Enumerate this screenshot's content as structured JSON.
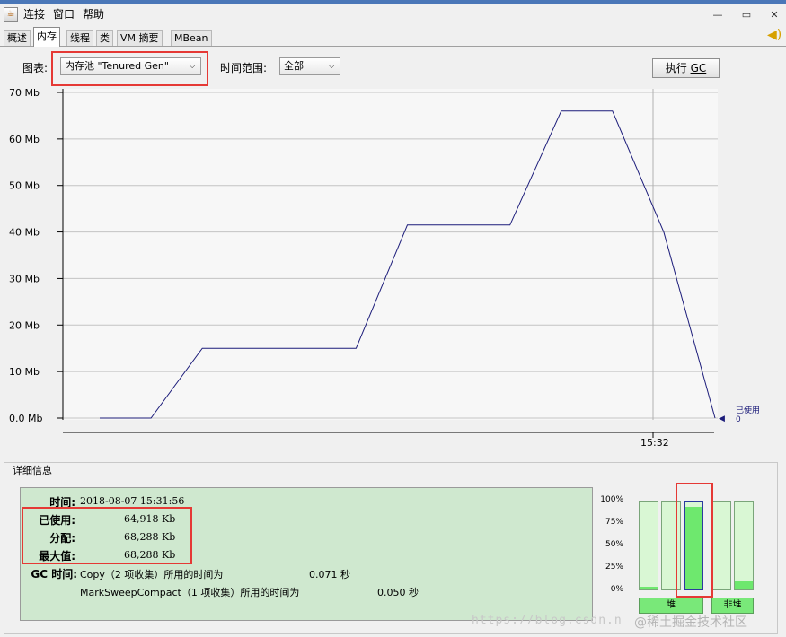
{
  "app": {
    "menu": [
      "连接",
      "窗口",
      "帮助"
    ]
  },
  "window_buttons": {
    "minimize": "—",
    "restore": "▭",
    "close": "✕"
  },
  "tabs": [
    "概述",
    "内存",
    "线程",
    "类",
    "VM 摘要",
    "MBean"
  ],
  "active_tab": "内存",
  "controls": {
    "chart_label": "图表:",
    "chart_value": "内存池 \"Tenured Gen\"",
    "range_label": "时间范围:",
    "range_value": "全部",
    "gc_button_prefix": "执行 ",
    "gc_button_accel": "GC"
  },
  "chart_data": {
    "type": "line",
    "yticks": [
      "70 Mb",
      "60 Mb",
      "50 Mb",
      "40 Mb",
      "30 Mb",
      "20 Mb",
      "10 Mb",
      "0.0 Mb"
    ],
    "ylim": [
      0,
      70
    ],
    "xtick": "15:32",
    "series": [
      {
        "name": "已使用",
        "points": [
          [
            0,
            0
          ],
          [
            4,
            0
          ],
          [
            8,
            15
          ],
          [
            12,
            15
          ],
          [
            16,
            15
          ],
          [
            20,
            15
          ],
          [
            24,
            41.5
          ],
          [
            28,
            41.5
          ],
          [
            32,
            41.5
          ],
          [
            36,
            66
          ],
          [
            40,
            66
          ],
          [
            44,
            40
          ],
          [
            48,
            0
          ]
        ]
      }
    ],
    "legend_label": "已使用",
    "legend_value": "0",
    "line_color": "#1c1c7a"
  },
  "details": {
    "title": "详细信息",
    "time_label": "时间:",
    "time_value": "2018-08-07 15:31:56",
    "used_label": "已使用:",
    "used_value": "64,918 Kb",
    "committed_label": "分配:",
    "committed_value": "68,288 Kb",
    "max_label": "最大值:",
    "max_value": "68,288 Kb",
    "gc_label": "GC 时间:",
    "gc1_desc": "Copy（2 项收集）所用的时间为",
    "gc1_time": "0.071 秒",
    "gc2_desc": "MarkSweepCompact（1 项收集）所用的时间为",
    "gc2_time": "0.050 秒"
  },
  "memory_bars": {
    "percent_labels": [
      "100%",
      "75%",
      "50%",
      "25%",
      "0%"
    ],
    "heap_label": "堆",
    "nonheap_label": "非堆",
    "heap_levels": [
      0.03,
      0.0,
      0.95
    ],
    "nonheap_levels": [
      0.0,
      0.09
    ]
  },
  "watermark": {
    "url": "https://blog.csdn.n",
    "community": "@稀土掘金技术社区"
  }
}
